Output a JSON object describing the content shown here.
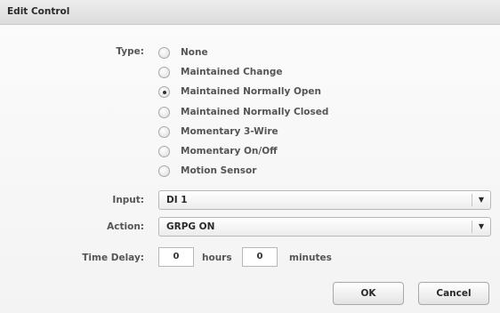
{
  "dialog": {
    "title": "Edit Control"
  },
  "form": {
    "type_label": "Type:",
    "type_options": [
      {
        "label": "None",
        "checked": false
      },
      {
        "label": "Maintained Change",
        "checked": false
      },
      {
        "label": "Maintained Normally Open",
        "checked": true
      },
      {
        "label": "Maintained Normally Closed",
        "checked": false
      },
      {
        "label": "Momentary 3-Wire",
        "checked": false
      },
      {
        "label": "Momentary On/Off",
        "checked": false
      },
      {
        "label": "Motion Sensor",
        "checked": false
      }
    ],
    "input_label": "Input:",
    "input_value": "DI 1",
    "action_label": "Action:",
    "action_value": "GRPG ON",
    "time_delay_label": "Time Delay:",
    "hours_value": "0",
    "hours_label": "hours",
    "minutes_value": "0",
    "minutes_label": "minutes"
  },
  "buttons": {
    "ok": "OK",
    "cancel": "Cancel"
  },
  "icons": {
    "dropdown": "chevron-down-icon",
    "radio": "radio-icon"
  }
}
